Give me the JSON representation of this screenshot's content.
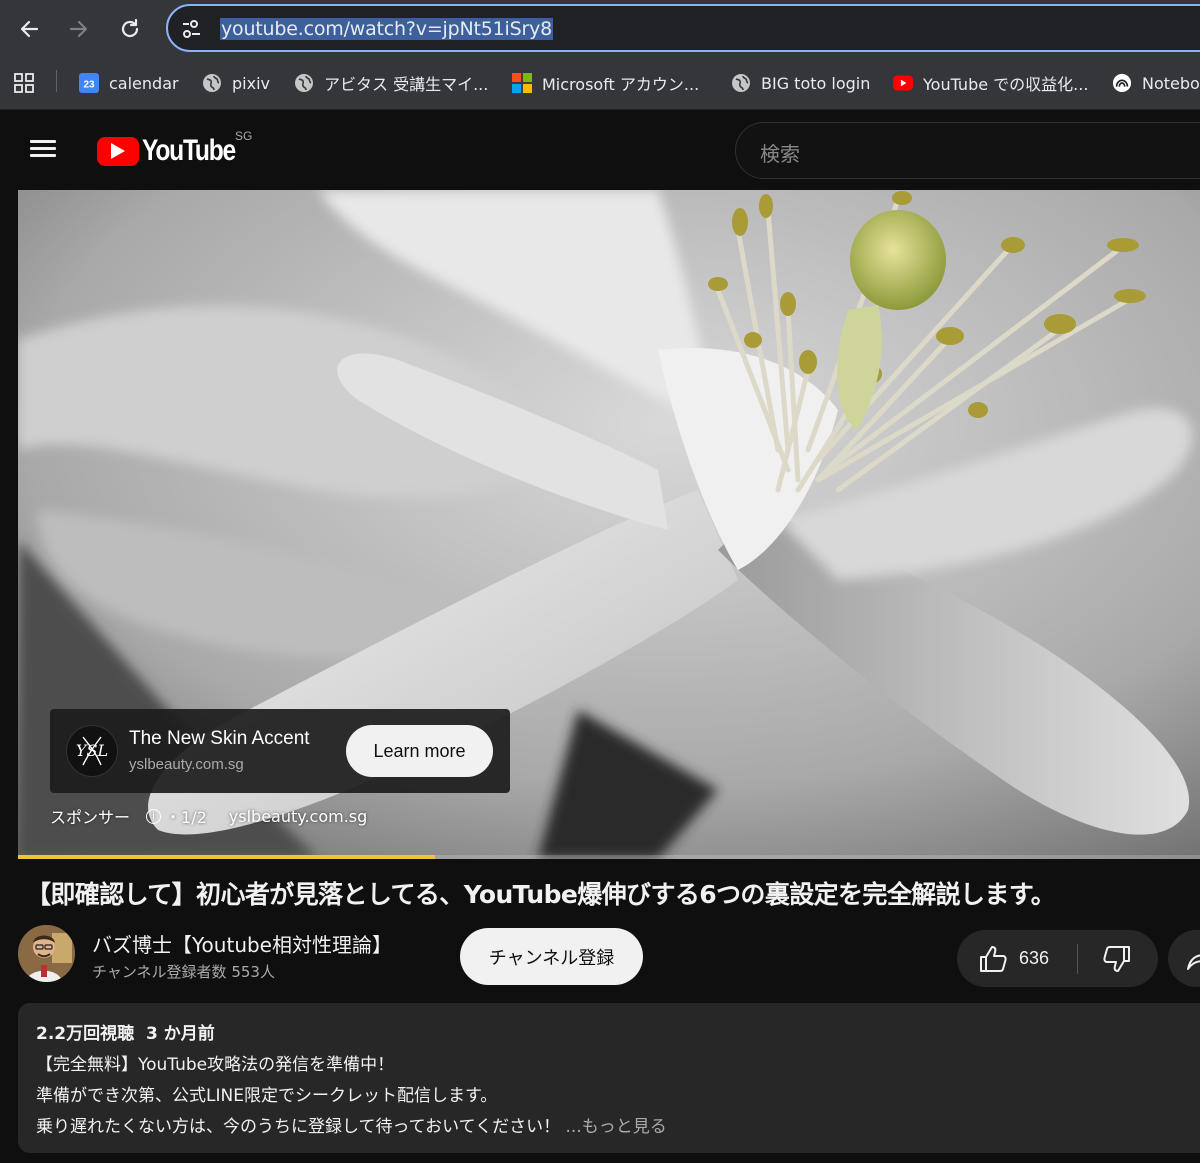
{
  "browser": {
    "url": "youtube.com/watch?v=jpNt51iSry8",
    "bookmarks": [
      {
        "label": "calendar",
        "icon": "calendar-icon",
        "badge": "23"
      },
      {
        "label": "pixiv",
        "icon": "globe-icon"
      },
      {
        "label": "アビタス 受講生マイ...",
        "icon": "globe-icon"
      },
      {
        "label": "Microsoft アカウン...",
        "icon": "microsoft-icon"
      },
      {
        "label": "BIG toto login",
        "icon": "globe-icon"
      },
      {
        "label": "YouTube での収益化...",
        "icon": "youtube-icon"
      },
      {
        "label": "Notebo",
        "icon": "notebook-icon"
      }
    ]
  },
  "header": {
    "logo_text": "YouTube",
    "region": "SG",
    "search_placeholder": "検索"
  },
  "player": {
    "ad": {
      "title": "The New Skin Accent",
      "domain": "yslbeauty.com.sg",
      "cta": "Learn more",
      "brand_logo_text": "YSL",
      "sponsor_label": "スポンサー",
      "info_glyph": "i",
      "count": "・1/2",
      "meta_domain": "yslbeauty.com.sg"
    },
    "progress": 0.353
  },
  "video": {
    "title": "【即確認して】初心者が見落としてる、YouTube爆伸びする6つの裏設定を完全解説します。",
    "channel_name": "バズ博士【Youtube相対性理論】",
    "subscribers": "チャンネル登録者数 553人",
    "subscribe_label": "チャンネル登録",
    "likes": "636"
  },
  "description": {
    "views": "2.2万回視聴",
    "age": "3 か月前",
    "lines": [
      "【完全無料】YouTube攻略法の発信を準備中！",
      "準備ができ次第、公式LINE限定でシークレット配信します。",
      "乗り遅れたくない方は、今のうちに登録して待っておいてください！"
    ],
    "more": "...もっと見る"
  },
  "colors": {
    "accent": "#8ab4f8",
    "youtube_red": "#ff0000",
    "progress_yellow": "#f4c430"
  }
}
